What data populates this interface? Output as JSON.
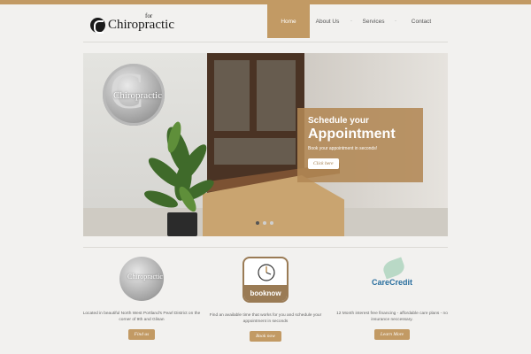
{
  "colors": {
    "accent": "#c29a64",
    "background": "#f2f1ef"
  },
  "header": {
    "logo_small": "for",
    "logo_name": "Chiropractic",
    "nav": [
      {
        "label": "Home",
        "active": true
      },
      {
        "label": "About Us"
      },
      {
        "label": "Services"
      },
      {
        "label": "Contact"
      }
    ],
    "separator": "-"
  },
  "hero": {
    "logo_letter": "C",
    "logo_text": "Chiropractic",
    "promo_line1": "Schedule your",
    "promo_line2": "Appointment",
    "promo_sub": "Book your appointment in seconds!",
    "promo_button": "Click here",
    "slides": 3,
    "active_slide": 1
  },
  "features": [
    {
      "icon": "chiropractic-logo-icon",
      "icon_text": "Chiropractic",
      "text": "Located in beautiful North West Portland's Pearl District on the corner of 9th and Glisan",
      "button": "Find us"
    },
    {
      "icon": "book-now-clock-icon",
      "icon_text": "booknow",
      "text": "Find an available time that works for you and schedule your appointment in seconds",
      "button": "Book now"
    },
    {
      "icon": "carecredit-logo-icon",
      "icon_text": "CareCredit",
      "text": "12 Month interest free financing - affordable care plans - no insurance neccessary.",
      "button": "Learn More"
    }
  ]
}
